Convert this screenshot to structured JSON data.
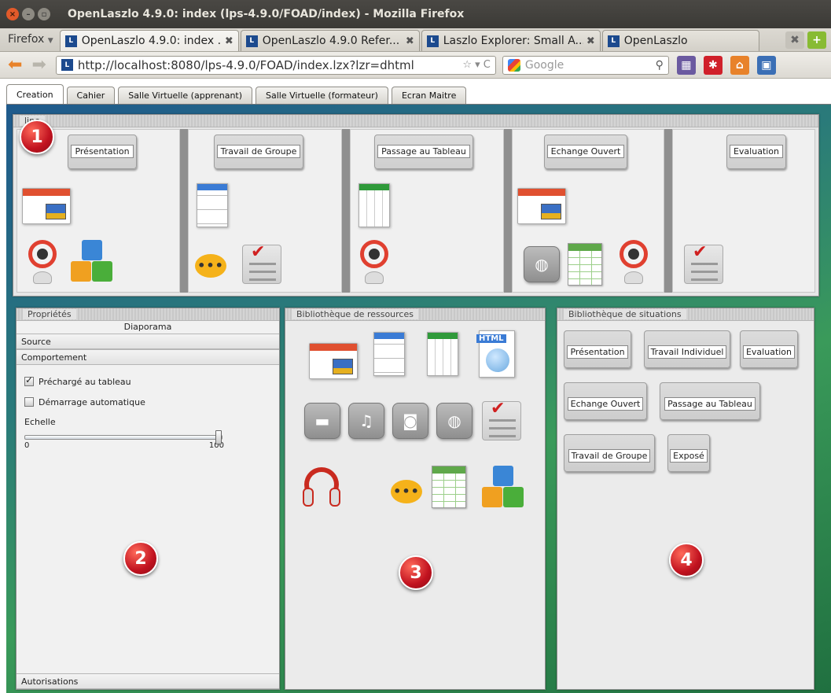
{
  "window": {
    "title": "OpenLaszlo 4.9.0: index (lps-4.9.0/FOAD/index) - Mozilla Firefox"
  },
  "browser": {
    "menu_label": "Firefox",
    "tabs": [
      {
        "label": "OpenLaszlo 4.9.0: index ...",
        "active": true
      },
      {
        "label": "OpenLaszlo 4.9.0 Refer...",
        "active": false
      },
      {
        "label": "Laszlo Explorer: Small A...",
        "active": false
      },
      {
        "label": "OpenLaszlo",
        "active": false
      }
    ],
    "url": "http://localhost:8080/lps-4.9.0/FOAD/index.lzx?lzr=dhtml",
    "search_placeholder": "Google"
  },
  "app": {
    "tabs": [
      "Creation",
      "Cahier",
      "Salle Virtuelle (apprenant)",
      "Salle Virtuelle (formateur)",
      "Ecran Maitre"
    ],
    "timeline": {
      "header": "Timeline",
      "header_visible": "line",
      "badge": "1",
      "columns": [
        {
          "button": "Présentation"
        },
        {
          "button": "Travail de Groupe"
        },
        {
          "button": "Passage au Tableau"
        },
        {
          "button": "Echange Ouvert"
        },
        {
          "button": "Evaluation"
        }
      ]
    },
    "properties": {
      "header": "Propriétés",
      "subtitle": "Diaporama",
      "section_source": "Source",
      "section_behaviour": "Comportement",
      "checkbox_preload": "Préchargé au tableau",
      "checkbox_preload_checked": true,
      "checkbox_autostart": "Démarrage automatique",
      "checkbox_autostart_checked": false,
      "scale_label": "Echelle",
      "scale_min": "0",
      "scale_max": "100",
      "scale_value": 100,
      "section_permissions": "Autorisations",
      "badge": "2"
    },
    "resources": {
      "header": "Bibliothèque de ressources",
      "html_tag": "HTML",
      "badge": "3"
    },
    "situations": {
      "header": "Bibliothèque de situations",
      "buttons": [
        "Présentation",
        "Travail Individuel",
        "Evaluation",
        "Echange Ouvert",
        "Passage au Tableau",
        "Travail de Groupe",
        "Exposé"
      ],
      "badge": "4"
    }
  }
}
